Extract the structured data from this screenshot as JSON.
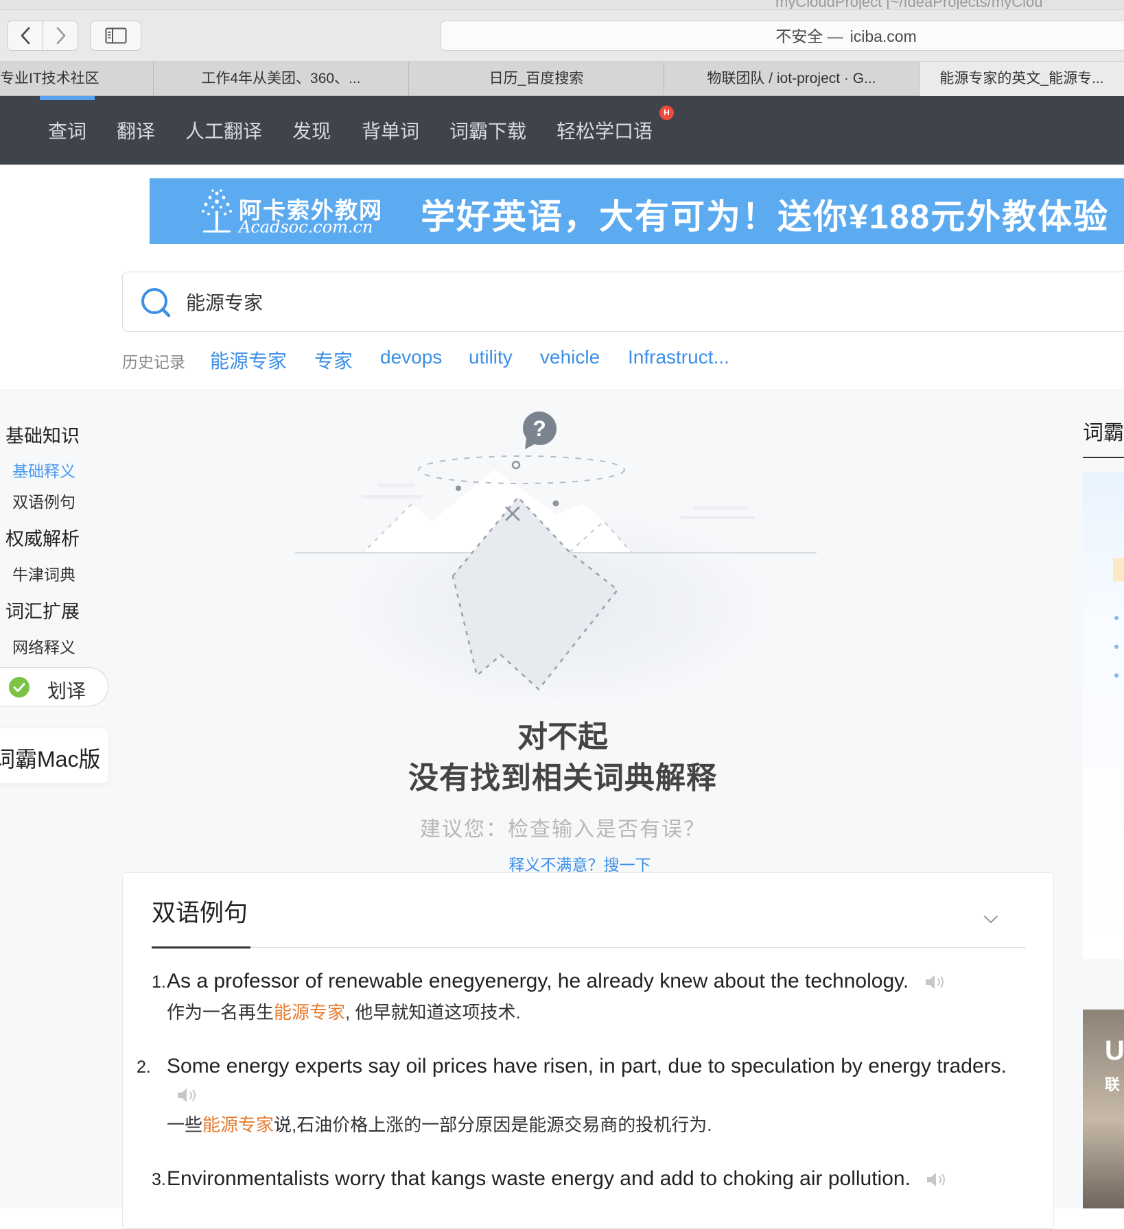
{
  "browser": {
    "window_title": "myCloudProject [~/IdeaProjects/myClou",
    "address_security": "不安全 —",
    "address_domain": "iciba.com",
    "tabs": [
      {
        "label": "专业IT技术社区"
      },
      {
        "label": "工作4年从美团、360、..."
      },
      {
        "label": "日历_百度搜索"
      },
      {
        "label": "物联团队 / iot-project · G..."
      },
      {
        "label": "能源专家的英文_能源专..."
      }
    ]
  },
  "site_nav": {
    "items": [
      "查词",
      "翻译",
      "人工翻译",
      "发现",
      "背单词",
      "词霸下载",
      "轻松学口语"
    ],
    "hot_badge": "H"
  },
  "banner": {
    "brand_cn": "阿卡索外教网",
    "brand_en": "Acadsoc.com.cn",
    "slogan": "学好英语，大有可为！送你¥188元外教体验"
  },
  "search": {
    "value": "能源专家"
  },
  "history": {
    "label": "历史记录",
    "items": [
      "能源专家",
      "专家",
      "devops",
      "utility",
      "vehicle",
      "Infrastruct..."
    ]
  },
  "left_nav": {
    "groups": [
      {
        "title": "基础知识",
        "items": [
          "基础释义",
          "双语例句"
        ]
      },
      {
        "title": "权威解析",
        "items": [
          "牛津词典"
        ]
      },
      {
        "title": "词汇扩展",
        "items": [
          "网络释义"
        ]
      }
    ],
    "huayi_label": "划译",
    "mac_label": "词霸Mac版"
  },
  "empty_state": {
    "title": "对不起",
    "subtitle": "没有找到相关词典解释",
    "suggestion": "建议您：检查输入是否有误？",
    "search_again": "释义不满意？搜一下"
  },
  "right_panel": {
    "title": "词霸",
    "ad_text_1": "U",
    "ad_text_2": "联"
  },
  "examples": {
    "title": "双语例句",
    "items": [
      {
        "num": "1.",
        "en": "As a professor of renewable enegyenergy, he already knew about the technology.",
        "cn_before": "作为一名再生",
        "cn_highlight": "能源专家",
        "cn_after": ", 他早就知道这项技术."
      },
      {
        "num": "2.",
        "en": "Some energy experts say oil prices have risen, in part, due to speculation by energy traders.",
        "cn_before": "一些",
        "cn_highlight": "能源专家",
        "cn_after": "说,石油价格上涨的一部分原因是能源交易商的投机行为."
      },
      {
        "num": "3.",
        "en": "Environmentalists worry that kangs waste energy and add to choking air pollution.",
        "cn_before": "",
        "cn_highlight": "",
        "cn_after": ""
      }
    ]
  },
  "colors": {
    "nav_bg": "#3f444c",
    "accent_blue": "#3b8fe6",
    "banner_blue": "#5cabf0",
    "highlight_orange": "#e87b2e"
  }
}
